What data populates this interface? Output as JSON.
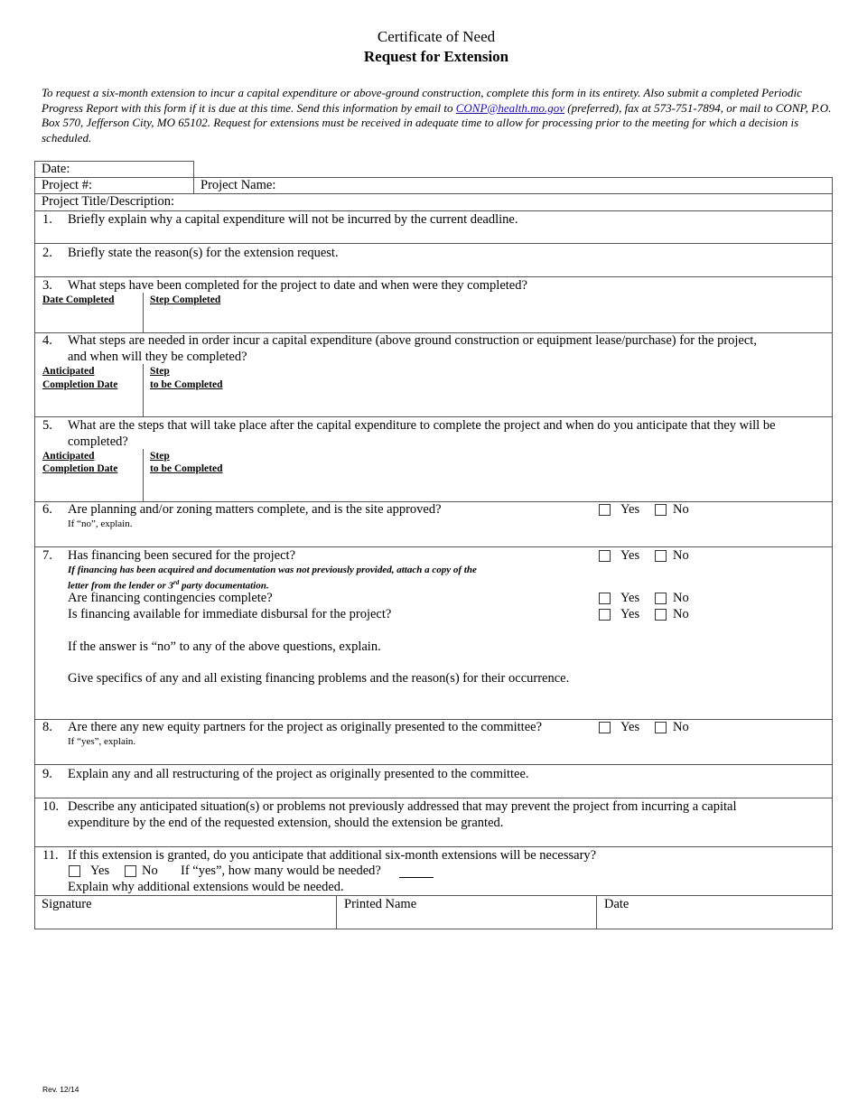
{
  "header": {
    "title": "Certificate of Need",
    "subtitle": "Request for Extension"
  },
  "intro": {
    "text_before_link": "To request a six-month extension to incur a capital expenditure or above-ground construction, complete this form in its entirety. Also submit a completed Periodic Progress Report with this form if it is due at this time. Send this information by email to ",
    "email_link": "CONP@health.mo.gov",
    "text_after_link": " (preferred), fax at 573-751-7894, or mail to CONP, P.O. Box 570, Jefferson City, MO 65102. Request for extensions must be received in adequate time to allow for processing prior to the meeting for which a decision is scheduled."
  },
  "fields": {
    "date_label": "Date:",
    "project_number_label": "Project #:",
    "project_name_label": "Project Name:",
    "project_title_label": "Project Title/Description:"
  },
  "options": {
    "yes": "Yes",
    "no": "No"
  },
  "questions": {
    "q1": {
      "num": "1.",
      "text": "Briefly explain why a capital expenditure will not be incurred by the current deadline."
    },
    "q2": {
      "num": "2.",
      "text": "Briefly state the reason(s) for the extension request."
    },
    "q3": {
      "num": "3.",
      "text": "What steps have been completed for the project to date and when were they completed?",
      "col1": "Date Completed",
      "col2": "Step Completed"
    },
    "q4": {
      "num": "4.",
      "line1": "What steps are needed in order incur a capital expenditure (above ground construction or equipment lease/purchase) for the project,",
      "line2": "and when will they be completed?",
      "col1_line1": "Anticipated",
      "col1_line2": "Completion Date",
      "col2_line1": "Step",
      "col2_line2": "to be Completed"
    },
    "q5": {
      "num": "5.",
      "line1": "What are the steps that will take place after the capital expenditure to complete the project and when do you anticipate that they will be",
      "line2": "completed?",
      "col1_line1": "Anticipated",
      "col1_line2": "Completion Date",
      "col2_line1": "Step",
      "col2_line2": "to be Completed"
    },
    "q6": {
      "num": "6.",
      "text": "Are planning and/or zoning matters complete, and is the site approved?",
      "note": "If “no”, explain."
    },
    "q7": {
      "num": "7.",
      "text": "Has financing been secured for the project?",
      "note_line1": "If financing has been acquired and documentation was not previously provided, attach a copy of the",
      "note_line2_a": "letter from the lender or 3",
      "note_line2_sup": "rd",
      "note_line2_b": " party documentation.",
      "sub1": "Are financing contingencies complete?",
      "sub2": "Is financing available for immediate disbursal for the project?",
      "explain1": "If the answer is “no” to any of the above questions, explain.",
      "explain2": "Give specifics of any and all existing financing problems and the reason(s) for their occurrence."
    },
    "q8": {
      "num": "8.",
      "text": "Are there any new equity partners for the project as originally presented to the committee?",
      "note": "If “yes”, explain."
    },
    "q9": {
      "num": "9.",
      "text": "Explain any and all restructuring of the project as originally presented to the committee."
    },
    "q10": {
      "num": "10.",
      "line1": "Describe any anticipated situation(s) or problems not previously addressed that may prevent the project from incurring a capital",
      "line2": "expenditure by the end of the requested extension, should the extension be granted."
    },
    "q11": {
      "num": "11.",
      "text": "If this extension is granted, do you anticipate that additional six-month extensions will be necessary?",
      "how_many": "If “yes”, how many would be needed?",
      "explain": "Explain why additional extensions would be needed."
    }
  },
  "signature_row": {
    "signature": "Signature",
    "printed_name": "Printed Name",
    "date": "Date"
  },
  "footer": {
    "revision": "Rev. 12/14"
  }
}
